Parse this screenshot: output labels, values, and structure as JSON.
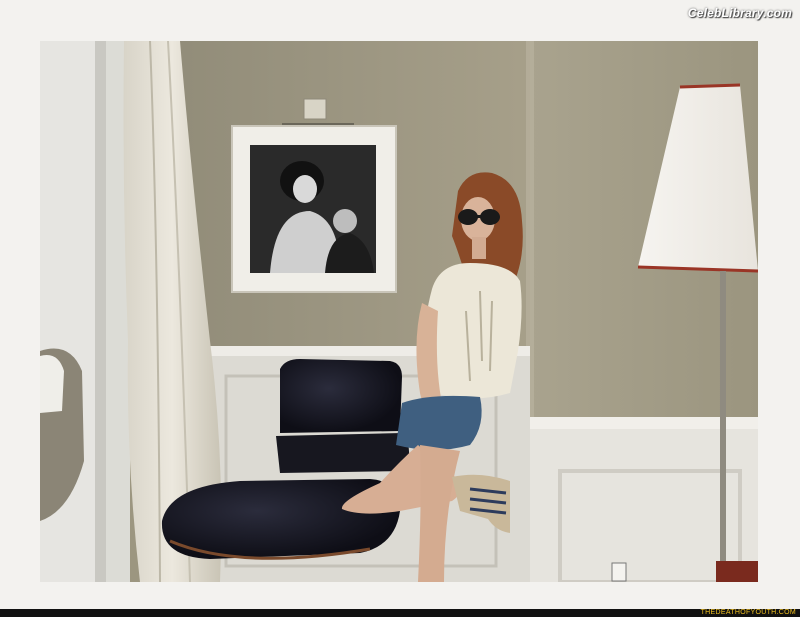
{
  "watermarks": {
    "top_right": "CelebLibrary.com",
    "bottom_right": "THEDEATHOFYOUTH.COM"
  },
  "scene": {
    "colors": {
      "frame": "#f3f2ef",
      "wall": "#a39c85",
      "wainscot": "#e4e2dc",
      "chair": "#14141e",
      "lampshade": "#f4f2ee",
      "lamp_trim": "#9a3526"
    }
  }
}
